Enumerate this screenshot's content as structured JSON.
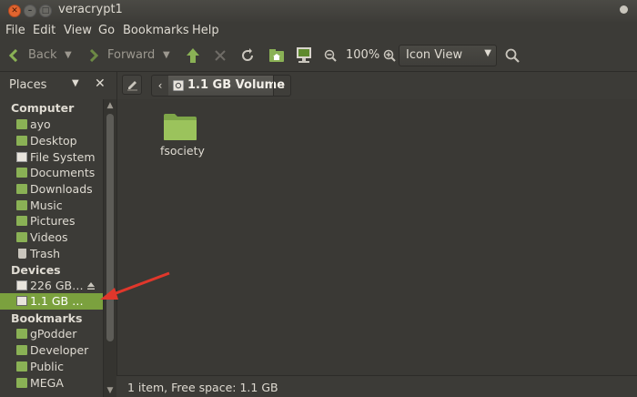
{
  "window": {
    "title": "veracrypt1"
  },
  "menu": {
    "items": [
      "File",
      "Edit",
      "View",
      "Go",
      "Bookmarks",
      "Help"
    ]
  },
  "toolbar": {
    "back_label": "Back",
    "forward_label": "Forward",
    "zoom": "100%",
    "view_mode": "Icon View"
  },
  "location": {
    "places_label": "Places",
    "current_crumb": "1.1 GB Volume"
  },
  "sidebar": {
    "computer_header": "Computer",
    "computer_items": [
      {
        "label": "ayo",
        "icon": "home-folder-icon"
      },
      {
        "label": "Desktop",
        "icon": "desktop-folder-icon"
      },
      {
        "label": "File System",
        "icon": "drive-icon"
      },
      {
        "label": "Documents",
        "icon": "documents-folder-icon"
      },
      {
        "label": "Downloads",
        "icon": "downloads-folder-icon"
      },
      {
        "label": "Music",
        "icon": "music-folder-icon"
      },
      {
        "label": "Pictures",
        "icon": "pictures-folder-icon"
      },
      {
        "label": "Videos",
        "icon": "videos-folder-icon"
      },
      {
        "label": "Trash",
        "icon": "trash-icon"
      }
    ],
    "devices_header": "Devices",
    "device_items": [
      {
        "label": "226 GB…",
        "icon": "drive-icon"
      },
      {
        "label": "1.1 GB …",
        "icon": "drive-icon",
        "selected": true
      }
    ],
    "bookmarks_header": "Bookmarks",
    "bookmark_items": [
      {
        "label": "gPodder",
        "icon": "folder-icon"
      },
      {
        "label": "Developer",
        "icon": "folder-icon"
      },
      {
        "label": "Public",
        "icon": "folder-icon"
      },
      {
        "label": "MEGA",
        "icon": "folder-icon"
      }
    ]
  },
  "content": {
    "items": [
      {
        "label": "fsociety",
        "icon": "folder-icon"
      }
    ]
  },
  "status": {
    "text": "1 item, Free space: 1.1 GB"
  },
  "colors": {
    "accent": "#7ba13e",
    "folder": "#8ab155",
    "arrow": "#e0372b",
    "close": "#e2652f"
  }
}
